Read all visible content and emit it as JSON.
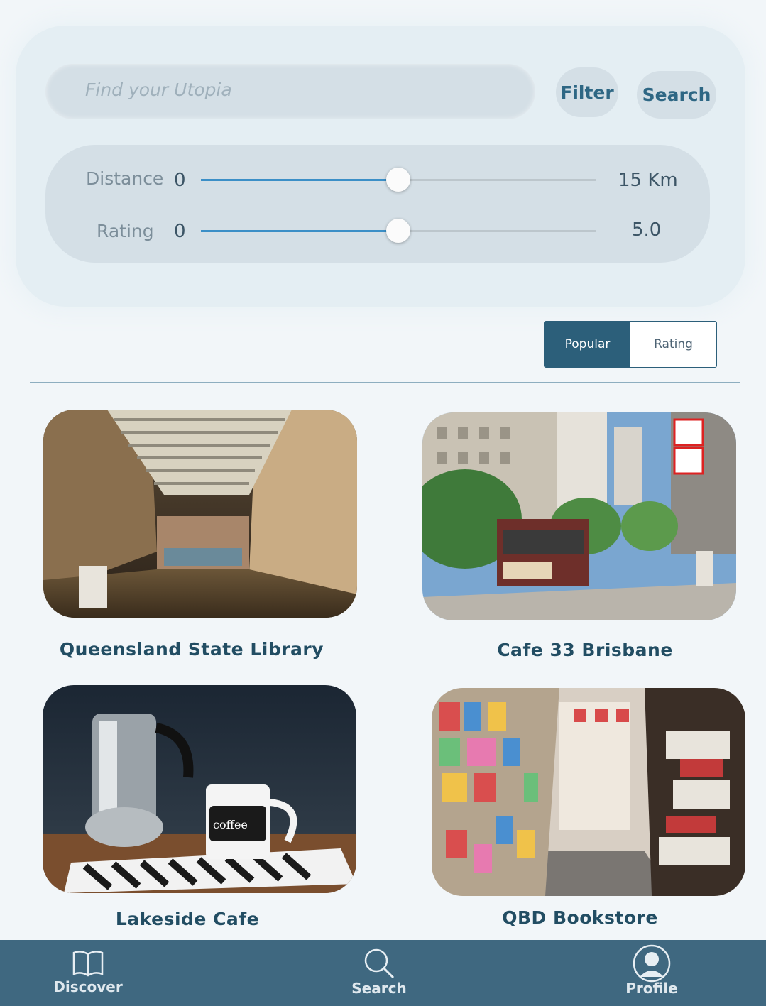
{
  "search": {
    "placeholder": "Find your Utopia",
    "filter_label": "Filter",
    "search_label": "Search"
  },
  "filters": {
    "distance": {
      "label": "Distance",
      "min": "0",
      "max": "15 Km",
      "value_fraction": 0.5
    },
    "rating": {
      "label": "Rating",
      "min": "0",
      "max": "5.0",
      "value_fraction": 0.5
    }
  },
  "sort": {
    "options": [
      "Popular",
      "Rating"
    ],
    "selected": "Popular"
  },
  "places": [
    {
      "name": "Queensland State Library",
      "image": "library-hall-photo"
    },
    {
      "name": "Cafe 33 Brisbane",
      "image": "cable-car-street-photo"
    },
    {
      "name": "Lakeside Cafe",
      "image": "coffee-mug-photo"
    },
    {
      "name": "QBD Bookstore",
      "image": "bookstore-aisle-photo"
    }
  ],
  "nav": {
    "items": [
      {
        "label": "Discover",
        "icon": "book-icon"
      },
      {
        "label": "Search",
        "icon": "magnifier-icon"
      },
      {
        "label": "Profile",
        "icon": "user-avatar-icon"
      }
    ]
  },
  "colors": {
    "accent": "#2c5f7a",
    "nav_bg": "#3f6880",
    "slider_fill": "#3b8fc7"
  }
}
